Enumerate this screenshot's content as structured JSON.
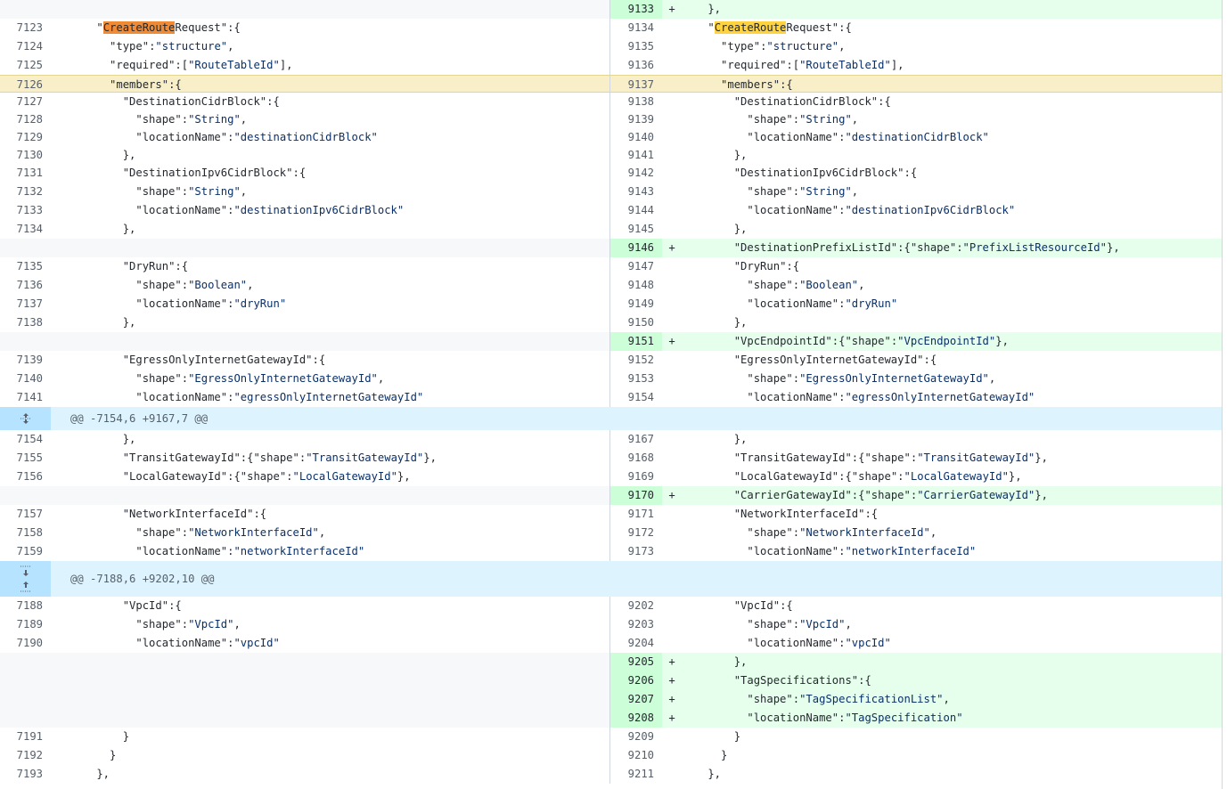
{
  "hunks": [
    {
      "header": "@@ -7154,6 +9167,7 @@"
    },
    {
      "header": "@@ -7188,6 +9202,10 @@"
    }
  ],
  "highlight": {
    "left_prefix": "\"",
    "match": "CreateRoute",
    "suffix": "Request\":{"
  },
  "rows": [
    {
      "l_num": "",
      "l_code": "",
      "r_num": "9133",
      "r_sign": "+",
      "r_code": "    },",
      "type": "add-only"
    },
    {
      "l_num": "7123",
      "l_code": "",
      "r_num": "9134",
      "r_code": "",
      "type": "hl-create"
    },
    {
      "l_num": "7124",
      "l_code": "      \"type\":\"structure\",",
      "r_num": "9135",
      "r_code": "      \"type\":\"structure\","
    },
    {
      "l_num": "7125",
      "l_code": "      \"required\":[\"RouteTableId\"],",
      "r_num": "9136",
      "r_code": "      \"required\":[\"RouteTableId\"],"
    },
    {
      "l_num": "7126",
      "l_code": "      \"members\":{",
      "r_num": "9137",
      "r_code": "      \"members\":{",
      "type": "hl"
    },
    {
      "l_num": "7127",
      "l_code": "        \"DestinationCidrBlock\":{",
      "r_num": "9138",
      "r_code": "        \"DestinationCidrBlock\":{"
    },
    {
      "l_num": "7128",
      "l_code": "          \"shape\":\"String\",",
      "r_num": "9139",
      "r_code": "          \"shape\":\"String\","
    },
    {
      "l_num": "7129",
      "l_code": "          \"locationName\":\"destinationCidrBlock\"",
      "r_num": "9140",
      "r_code": "          \"locationName\":\"destinationCidrBlock\""
    },
    {
      "l_num": "7130",
      "l_code": "        },",
      "r_num": "9141",
      "r_code": "        },"
    },
    {
      "l_num": "7131",
      "l_code": "        \"DestinationIpv6CidrBlock\":{",
      "r_num": "9142",
      "r_code": "        \"DestinationIpv6CidrBlock\":{"
    },
    {
      "l_num": "7132",
      "l_code": "          \"shape\":\"String\",",
      "r_num": "9143",
      "r_code": "          \"shape\":\"String\","
    },
    {
      "l_num": "7133",
      "l_code": "          \"locationName\":\"destinationIpv6CidrBlock\"",
      "r_num": "9144",
      "r_code": "          \"locationName\":\"destinationIpv6CidrBlock\""
    },
    {
      "l_num": "7134",
      "l_code": "        },",
      "r_num": "9145",
      "r_code": "        },"
    },
    {
      "l_num": "",
      "l_code": "",
      "r_num": "9146",
      "r_sign": "+",
      "r_code": "        \"DestinationPrefixListId\":{\"shape\":\"PrefixListResourceId\"},",
      "type": "add-only"
    },
    {
      "l_num": "7135",
      "l_code": "        \"DryRun\":{",
      "r_num": "9147",
      "r_code": "        \"DryRun\":{"
    },
    {
      "l_num": "7136",
      "l_code": "          \"shape\":\"Boolean\",",
      "r_num": "9148",
      "r_code": "          \"shape\":\"Boolean\","
    },
    {
      "l_num": "7137",
      "l_code": "          \"locationName\":\"dryRun\"",
      "r_num": "9149",
      "r_code": "          \"locationName\":\"dryRun\""
    },
    {
      "l_num": "7138",
      "l_code": "        },",
      "r_num": "9150",
      "r_code": "        },"
    },
    {
      "l_num": "",
      "l_code": "",
      "r_num": "9151",
      "r_sign": "+",
      "r_code": "        \"VpcEndpointId\":{\"shape\":\"VpcEndpointId\"},",
      "type": "add-only"
    },
    {
      "l_num": "7139",
      "l_code": "        \"EgressOnlyInternetGatewayId\":{",
      "r_num": "9152",
      "r_code": "        \"EgressOnlyInternetGatewayId\":{"
    },
    {
      "l_num": "7140",
      "l_code": "          \"shape\":\"EgressOnlyInternetGatewayId\",",
      "r_num": "9153",
      "r_code": "          \"shape\":\"EgressOnlyInternetGatewayId\","
    },
    {
      "l_num": "7141",
      "l_code": "          \"locationName\":\"egressOnlyInternetGatewayId\"",
      "r_num": "9154",
      "r_code": "          \"locationName\":\"egressOnlyInternetGatewayId\""
    },
    {
      "type": "hunk",
      "hunk": 0,
      "icon": "expand-both-icon"
    },
    {
      "l_num": "7154",
      "l_code": "        },",
      "r_num": "9167",
      "r_code": "        },"
    },
    {
      "l_num": "7155",
      "l_code": "        \"TransitGatewayId\":{\"shape\":\"TransitGatewayId\"},",
      "r_num": "9168",
      "r_code": "        \"TransitGatewayId\":{\"shape\":\"TransitGatewayId\"},"
    },
    {
      "l_num": "7156",
      "l_code": "        \"LocalGatewayId\":{\"shape\":\"LocalGatewayId\"},",
      "r_num": "9169",
      "r_code": "        \"LocalGatewayId\":{\"shape\":\"LocalGatewayId\"},"
    },
    {
      "l_num": "",
      "l_code": "",
      "r_num": "9170",
      "r_sign": "+",
      "r_code": "        \"CarrierGatewayId\":{\"shape\":\"CarrierGatewayId\"},",
      "type": "add-only"
    },
    {
      "l_num": "7157",
      "l_code": "        \"NetworkInterfaceId\":{",
      "r_num": "9171",
      "r_code": "        \"NetworkInterfaceId\":{"
    },
    {
      "l_num": "7158",
      "l_code": "          \"shape\":\"NetworkInterfaceId\",",
      "r_num": "9172",
      "r_code": "          \"shape\":\"NetworkInterfaceId\","
    },
    {
      "l_num": "7159",
      "l_code": "          \"locationName\":\"networkInterfaceId\"",
      "r_num": "9173",
      "r_code": "          \"locationName\":\"networkInterfaceId\""
    },
    {
      "type": "hunk",
      "hunk": 1,
      "icon": "expand-up-down-icon"
    },
    {
      "l_num": "7188",
      "l_code": "        \"VpcId\":{",
      "r_num": "9202",
      "r_code": "        \"VpcId\":{"
    },
    {
      "l_num": "7189",
      "l_code": "          \"shape\":\"VpcId\",",
      "r_num": "9203",
      "r_code": "          \"shape\":\"VpcId\","
    },
    {
      "l_num": "7190",
      "l_code": "          \"locationName\":\"vpcId\"",
      "r_num": "9204",
      "r_code": "          \"locationName\":\"vpcId\""
    },
    {
      "l_num": "",
      "l_code": "",
      "r_num": "9205",
      "r_sign": "+",
      "r_code": "        },",
      "type": "add-only"
    },
    {
      "l_num": "",
      "l_code": "",
      "r_num": "9206",
      "r_sign": "+",
      "r_code": "        \"TagSpecifications\":{",
      "type": "add-only"
    },
    {
      "l_num": "",
      "l_code": "",
      "r_num": "9207",
      "r_sign": "+",
      "r_code": "          \"shape\":\"TagSpecificationList\",",
      "type": "add-only"
    },
    {
      "l_num": "",
      "l_code": "",
      "r_num": "9208",
      "r_sign": "+",
      "r_code": "          \"locationName\":\"TagSpecification\"",
      "type": "add-only"
    },
    {
      "l_num": "7191",
      "l_code": "        }",
      "r_num": "9209",
      "r_code": "        }"
    },
    {
      "l_num": "7192",
      "l_code": "      }",
      "r_num": "9210",
      "r_code": "      }"
    },
    {
      "l_num": "7193",
      "l_code": "    },",
      "r_num": "9211",
      "r_code": "    },"
    }
  ]
}
